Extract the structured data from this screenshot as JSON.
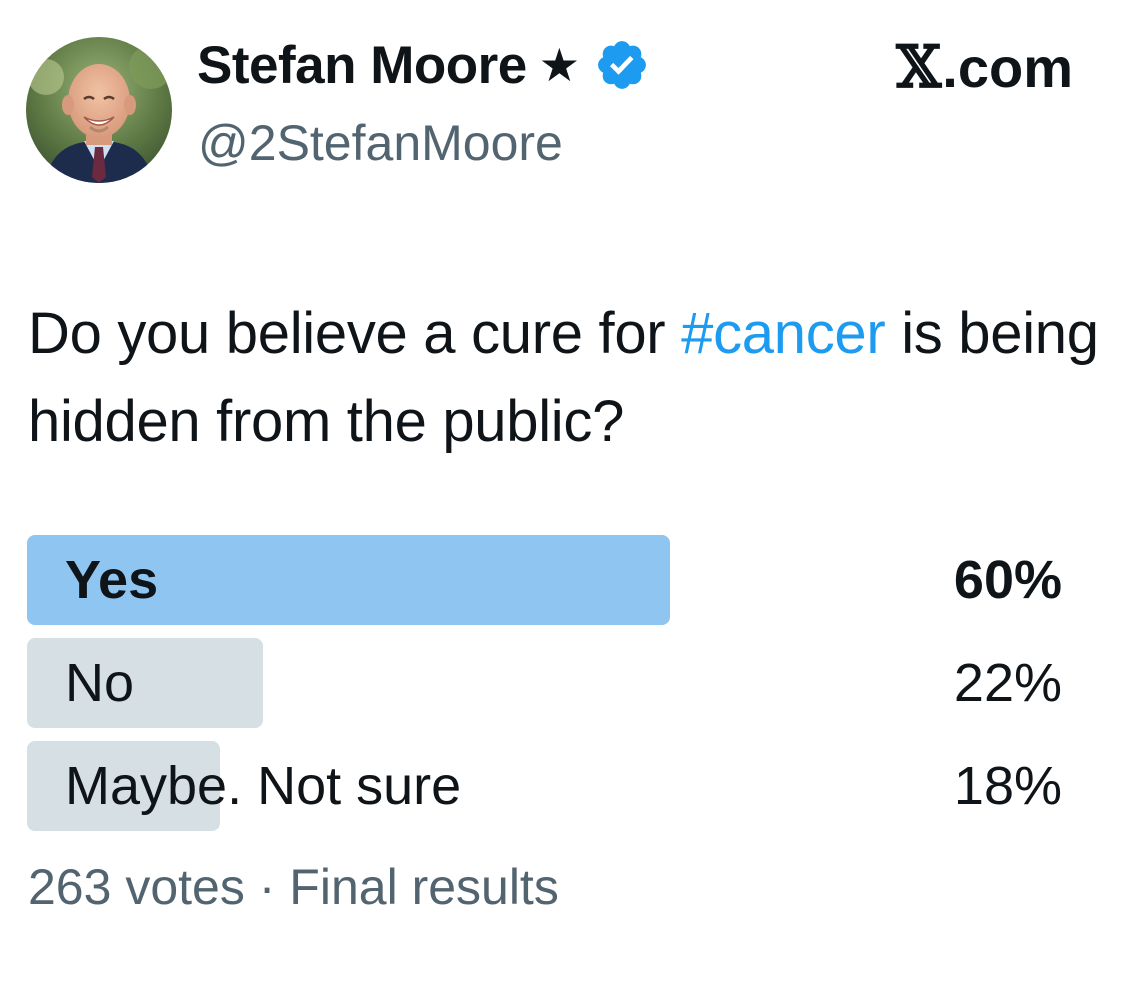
{
  "author": {
    "display_name": "Stefan Moore",
    "star": "★",
    "handle": "@2StefanMoore",
    "verified_color": "#1d9bf0",
    "icons": [
      "avatar",
      "star-icon",
      "verified-badge-icon"
    ]
  },
  "brand": {
    "x_glyph": "𝕏",
    "suffix": ".com"
  },
  "tweet": {
    "text_before": "Do you believe a cure for ",
    "hashtag": "#cancer",
    "text_after": " is being hidden from the public?",
    "hashtag_color": "#1d9bf0"
  },
  "poll": {
    "options": [
      {
        "label": "Yes",
        "percent": "60%",
        "fraction": 0.6,
        "winner": true
      },
      {
        "label": "No",
        "percent": "22%",
        "fraction": 0.22,
        "winner": false
      },
      {
        "label": "Maybe. Not sure",
        "percent": "18%",
        "fraction": 0.18,
        "winner": false
      }
    ],
    "votes": "263 votes",
    "separator": "·",
    "status": "Final results",
    "winner_color": "#8ec5f1",
    "other_color": "#cfd9de"
  }
}
